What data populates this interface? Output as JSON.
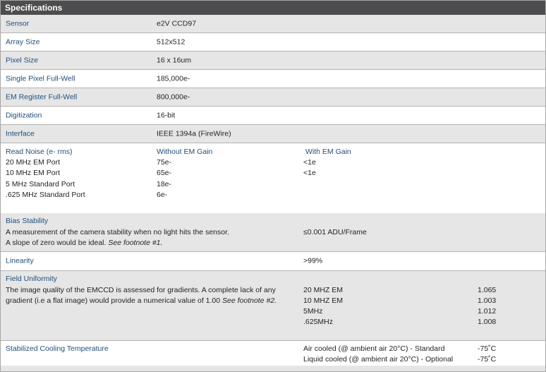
{
  "title": "Specifications",
  "simple_rows": [
    {
      "label": "Sensor",
      "value": "e2V CCD97"
    },
    {
      "label": "Array Size",
      "value": "512x512"
    },
    {
      "label": "Pixel Size",
      "value": "16 x 16um"
    },
    {
      "label": "Single Pixel Full-Well",
      "value": "185,000e-"
    },
    {
      "label": "EM Register Full-Well",
      "value": "800,000e-"
    },
    {
      "label": "Digitization",
      "value": "16-bit"
    },
    {
      "label": "Interface",
      "value": "IEEE 1394a (FireWire)"
    }
  ],
  "read_noise": {
    "label": "Read Noise (e- rms)",
    "col_without": "Without EM Gain",
    "col_with": "With EM Gain",
    "rows": [
      {
        "port": "20 MHz EM Port",
        "without": "75e-",
        "with": "<1e"
      },
      {
        "port": "10 MHz EM Port",
        "without": "65e-",
        "with": "<1e"
      },
      {
        "port": "5 MHz Standard Port",
        "without": "18e-",
        "with": ""
      },
      {
        "port": ".625 MHz Standard Port",
        "without": "6e-",
        "with": ""
      }
    ]
  },
  "bias_stability": {
    "label": "Bias Stability",
    "desc_line1": "A measurement of the camera stability when no light hits the sensor.",
    "desc_line2": "A slope of zero would be ideal.",
    "desc_note": "See footnote #1.",
    "value": "≤0.001 ADU/Frame"
  },
  "linearity": {
    "label": "Linearity",
    "value": ">99%"
  },
  "field_uniformity": {
    "label": "Field Uniformity",
    "desc_line1": "The image quality of the EMCCD is assessed for gradients. A complete lack of any",
    "desc_line2": "gradient (i.e a flat image) would provide a numerical value of 1.00",
    "desc_note": "See footnote #2.",
    "rows": [
      {
        "mode": "20 MHZ EM",
        "value": "1.065"
      },
      {
        "mode": "10 MHZ EM",
        "value": "1.003"
      },
      {
        "mode": "5MHz",
        "value": "1.012"
      },
      {
        "mode": ".625MHz",
        "value": "1.008"
      }
    ]
  },
  "cooling": {
    "label": "Stabilized Cooling Temperature",
    "rows": [
      {
        "mode": "Air cooled (@ ambient air 20°C) - Standard",
        "value": "-75˚C"
      },
      {
        "mode": "Liquid cooled (@ ambient air 20°C) - Optional",
        "value": "-75˚C"
      }
    ]
  }
}
